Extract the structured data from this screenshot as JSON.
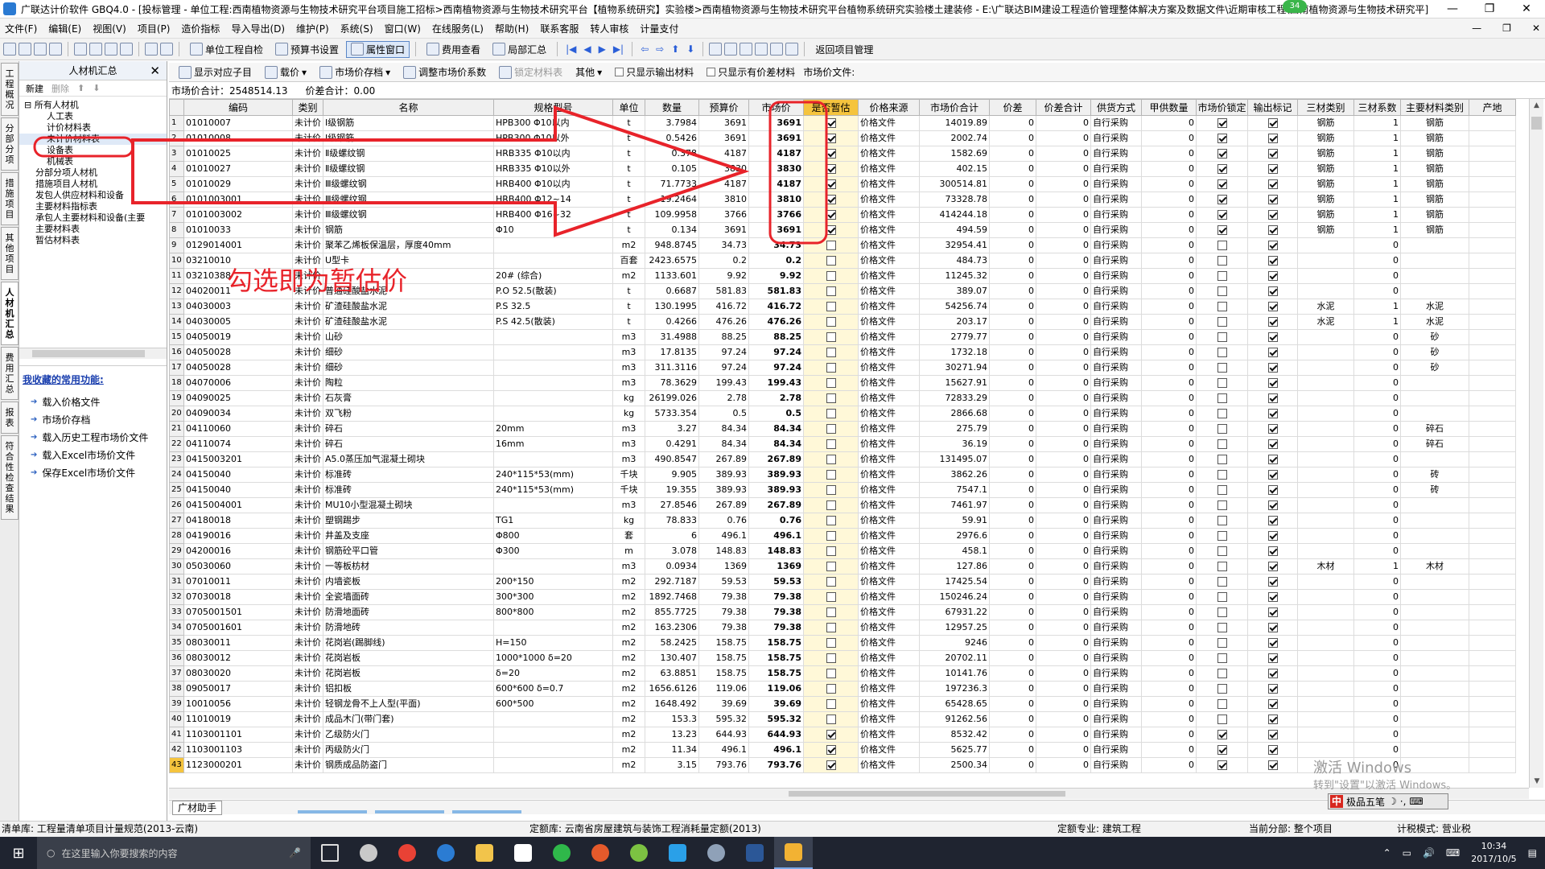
{
  "titlebar": {
    "title": "广联达计价软件 GBQ4.0 - [投标管理 - 单位工程:西南植物资源与生物技术研究平台项目施工招标>西南植物资源与生物技术研究平台【植物系统研究】实验楼>西南植物资源与生物技术研究平台植物系统研究实验楼土建装修 - E:\\广联达BIM建设工程造价管理整体解决方案及数据文件\\近期审核工程\\西南植物资源与生物技术研究平]",
    "badge": "34"
  },
  "menu": [
    "文件(F)",
    "编辑(E)",
    "视图(V)",
    "项目(P)",
    "造价指标",
    "导入导出(D)",
    "维护(P)",
    "系统(S)",
    "窗口(W)",
    "在线服务(L)",
    "帮助(H)",
    "联系客服",
    "转人审核",
    "计量支付"
  ],
  "toolbar": {
    "unit_check": "单位工程自检",
    "budget_setting": "预算书设置",
    "property_window": "属性窗口",
    "fee_view": "费用查看",
    "partial_summary": "局部汇总",
    "return_project": "返回项目管理"
  },
  "vtabs": [
    "工程概况",
    "分部分项",
    "措施项目",
    "其他项目",
    "人材机汇总",
    "费用汇总",
    "报表",
    "符合性检查结果"
  ],
  "left_panel": {
    "title": "人材机汇总",
    "new_label": "新建",
    "delete_label": "删除",
    "tree": [
      {
        "label": "所有人材机",
        "level": 0
      },
      {
        "label": "人工表",
        "level": 2
      },
      {
        "label": "计价材料表",
        "level": 2
      },
      {
        "label": "未计价材料表",
        "level": 2
      },
      {
        "label": "设备表",
        "level": 2
      },
      {
        "label": "机械表",
        "level": 2
      },
      {
        "label": "分部分项人材机",
        "level": 1
      },
      {
        "label": "措施项目人材机",
        "level": 1
      },
      {
        "label": "发包人供应材料和设备",
        "level": 1
      },
      {
        "label": "主要材料指标表",
        "level": 1
      },
      {
        "label": "承包人主要材料和设备(主要",
        "level": 1
      },
      {
        "label": "主要材料表",
        "level": 1
      },
      {
        "label": "暂估材料表",
        "level": 1
      }
    ],
    "fav_title": "我收藏的常用功能:",
    "fav_items": [
      "载入价格文件",
      "市场价存档",
      "载入历史工程市场价文件",
      "载入Excel市场价文件",
      "保存Excel市场价文件"
    ]
  },
  "sub_toolbar": {
    "show_sub": "显示对应子目",
    "pricing": "载价",
    "market_archive": "市场价存档",
    "adjust_coef": "调整市场价系数",
    "lock_material": "锁定材料表",
    "other": "其他",
    "only_output": "只显示输出材料",
    "only_diff": "只显示有价差材料",
    "market_file": "市场价文件:"
  },
  "summary": {
    "market_total": "市场价合计：2548514.13",
    "diff_total": "价差合计：0.00"
  },
  "table": {
    "headers": [
      "",
      "编码",
      "类别",
      "名称",
      "规格型号",
      "单位",
      "数量",
      "预算价",
      "市场价",
      "是否暂估",
      "价格来源",
      "市场价合计",
      "价差",
      "价差合计",
      "供货方式",
      "甲供数量",
      "市场价锁定",
      "输出标记",
      "三材类别",
      "三材系数",
      "主要材料类别",
      "产地"
    ],
    "rows": [
      [
        "1",
        "01010007",
        "未计价",
        "Ⅰ级钢筋",
        "HPB300 Φ10以内",
        "t",
        "3.7984",
        "3691",
        "3691",
        true,
        "价格文件",
        "14019.89",
        "0",
        "0",
        "自行采购",
        "0",
        true,
        true,
        "钢筋",
        "1",
        "钢筋",
        ""
      ],
      [
        "2",
        "01010008",
        "未计价",
        "Ⅰ级钢筋",
        "HPB300 Φ10以外",
        "t",
        "0.5426",
        "3691",
        "3691",
        true,
        "价格文件",
        "2002.74",
        "0",
        "0",
        "自行采购",
        "0",
        true,
        true,
        "钢筋",
        "1",
        "钢筋",
        ""
      ],
      [
        "3",
        "01010025",
        "未计价",
        "Ⅱ级螺纹钢",
        "HRB335 Φ10以内",
        "t",
        "0.378",
        "4187",
        "4187",
        true,
        "价格文件",
        "1582.69",
        "0",
        "0",
        "自行采购",
        "0",
        true,
        true,
        "钢筋",
        "1",
        "钢筋",
        ""
      ],
      [
        "4",
        "01010027",
        "未计价",
        "Ⅱ级螺纹钢",
        "HRB335 Φ10以外",
        "t",
        "0.105",
        "3830",
        "3830",
        true,
        "价格文件",
        "402.15",
        "0",
        "0",
        "自行采购",
        "0",
        true,
        true,
        "钢筋",
        "1",
        "钢筋",
        ""
      ],
      [
        "5",
        "01010029",
        "未计价",
        "Ⅲ级螺纹钢",
        "HRB400 Φ10以内",
        "t",
        "71.7733",
        "4187",
        "4187",
        true,
        "价格文件",
        "300514.81",
        "0",
        "0",
        "自行采购",
        "0",
        true,
        true,
        "钢筋",
        "1",
        "钢筋",
        ""
      ],
      [
        "6",
        "0101003001",
        "未计价",
        "Ⅲ级螺纹钢",
        "HRB400 Φ12~14",
        "t",
        "19.2464",
        "3810",
        "3810",
        true,
        "价格文件",
        "73328.78",
        "0",
        "0",
        "自行采购",
        "0",
        true,
        true,
        "钢筋",
        "1",
        "钢筋",
        ""
      ],
      [
        "7",
        "0101003002",
        "未计价",
        "Ⅲ级螺纹钢",
        "HRB400 Φ16~32",
        "t",
        "109.9958",
        "3766",
        "3766",
        true,
        "价格文件",
        "414244.18",
        "0",
        "0",
        "自行采购",
        "0",
        true,
        true,
        "钢筋",
        "1",
        "钢筋",
        ""
      ],
      [
        "8",
        "01010033",
        "未计价",
        "钢筋",
        "Φ10",
        "t",
        "0.134",
        "3691",
        "3691",
        true,
        "价格文件",
        "494.59",
        "0",
        "0",
        "自行采购",
        "0",
        true,
        true,
        "钢筋",
        "1",
        "钢筋",
        ""
      ],
      [
        "9",
        "0129014001",
        "未计价",
        "聚苯乙烯板保温层，厚度40mm",
        "",
        "m2",
        "948.8745",
        "34.73",
        "34.73",
        false,
        "价格文件",
        "32954.41",
        "0",
        "0",
        "自行采购",
        "0",
        false,
        true,
        "",
        "0",
        "",
        ""
      ],
      [
        "10",
        "03210010",
        "未计价",
        "U型卡",
        "",
        "百套",
        "2423.6575",
        "0.2",
        "0.2",
        false,
        "价格文件",
        "484.73",
        "0",
        "0",
        "自行采购",
        "0",
        false,
        true,
        "",
        "0",
        "",
        ""
      ],
      [
        "11",
        "03210388",
        "未计价",
        "",
        "20# (综合)",
        "m2",
        "1133.601",
        "9.92",
        "9.92",
        false,
        "价格文件",
        "11245.32",
        "0",
        "0",
        "自行采购",
        "0",
        false,
        true,
        "",
        "0",
        "",
        ""
      ],
      [
        "12",
        "04020011",
        "未计价",
        "普通硅酸盐水泥",
        "P.O 52.5(散装)",
        "t",
        "0.6687",
        "581.83",
        "581.83",
        false,
        "价格文件",
        "389.07",
        "0",
        "0",
        "自行采购",
        "0",
        false,
        true,
        "",
        "0",
        "",
        ""
      ],
      [
        "13",
        "04030003",
        "未计价",
        "矿渣硅酸盐水泥",
        "P.S 32.5",
        "t",
        "130.1995",
        "416.72",
        "416.72",
        false,
        "价格文件",
        "54256.74",
        "0",
        "0",
        "自行采购",
        "0",
        false,
        true,
        "水泥",
        "1",
        "水泥",
        ""
      ],
      [
        "14",
        "04030005",
        "未计价",
        "矿渣硅酸盐水泥",
        "P.S 42.5(散装)",
        "t",
        "0.4266",
        "476.26",
        "476.26",
        false,
        "价格文件",
        "203.17",
        "0",
        "0",
        "自行采购",
        "0",
        false,
        true,
        "水泥",
        "1",
        "水泥",
        ""
      ],
      [
        "15",
        "04050019",
        "未计价",
        "山砂",
        "",
        "m3",
        "31.4988",
        "88.25",
        "88.25",
        false,
        "价格文件",
        "2779.77",
        "0",
        "0",
        "自行采购",
        "0",
        false,
        true,
        "",
        "0",
        "砂",
        ""
      ],
      [
        "16",
        "04050028",
        "未计价",
        "细砂",
        "",
        "m3",
        "17.8135",
        "97.24",
        "97.24",
        false,
        "价格文件",
        "1732.18",
        "0",
        "0",
        "自行采购",
        "0",
        false,
        true,
        "",
        "0",
        "砂",
        ""
      ],
      [
        "17",
        "04050028",
        "未计价",
        "细砂",
        "",
        "m3",
        "311.3116",
        "97.24",
        "97.24",
        false,
        "价格文件",
        "30271.94",
        "0",
        "0",
        "自行采购",
        "0",
        false,
        true,
        "",
        "0",
        "砂",
        ""
      ],
      [
        "18",
        "04070006",
        "未计价",
        "陶粒",
        "",
        "m3",
        "78.3629",
        "199.43",
        "199.43",
        false,
        "价格文件",
        "15627.91",
        "0",
        "0",
        "自行采购",
        "0",
        false,
        true,
        "",
        "0",
        "",
        ""
      ],
      [
        "19",
        "04090025",
        "未计价",
        "石灰膏",
        "",
        "kg",
        "26199.026",
        "2.78",
        "2.78",
        false,
        "价格文件",
        "72833.29",
        "0",
        "0",
        "自行采购",
        "0",
        false,
        true,
        "",
        "0",
        "",
        ""
      ],
      [
        "20",
        "04090034",
        "未计价",
        "双飞粉",
        "",
        "kg",
        "5733.354",
        "0.5",
        "0.5",
        false,
        "价格文件",
        "2866.68",
        "0",
        "0",
        "自行采购",
        "0",
        false,
        true,
        "",
        "0",
        "",
        ""
      ],
      [
        "21",
        "04110060",
        "未计价",
        "碎石",
        "20mm",
        "m3",
        "3.27",
        "84.34",
        "84.34",
        false,
        "价格文件",
        "275.79",
        "0",
        "0",
        "自行采购",
        "0",
        false,
        true,
        "",
        "0",
        "碎石",
        ""
      ],
      [
        "22",
        "04110074",
        "未计价",
        "碎石",
        "16mm",
        "m3",
        "0.4291",
        "84.34",
        "84.34",
        false,
        "价格文件",
        "36.19",
        "0",
        "0",
        "自行采购",
        "0",
        false,
        true,
        "",
        "0",
        "碎石",
        ""
      ],
      [
        "23",
        "0415003201",
        "未计价",
        "A5.0蒸压加气混凝土砌块",
        "",
        "m3",
        "490.8547",
        "267.89",
        "267.89",
        false,
        "价格文件",
        "131495.07",
        "0",
        "0",
        "自行采购",
        "0",
        false,
        true,
        "",
        "0",
        "",
        ""
      ],
      [
        "24",
        "04150040",
        "未计价",
        "标准砖",
        "240*115*53(mm)",
        "千块",
        "9.905",
        "389.93",
        "389.93",
        false,
        "价格文件",
        "3862.26",
        "0",
        "0",
        "自行采购",
        "0",
        false,
        true,
        "",
        "0",
        "砖",
        ""
      ],
      [
        "25",
        "04150040",
        "未计价",
        "标准砖",
        "240*115*53(mm)",
        "千块",
        "19.355",
        "389.93",
        "389.93",
        false,
        "价格文件",
        "7547.1",
        "0",
        "0",
        "自行采购",
        "0",
        false,
        true,
        "",
        "0",
        "砖",
        ""
      ],
      [
        "26",
        "0415004001",
        "未计价",
        "MU10小型混凝土砌块",
        "",
        "m3",
        "27.8546",
        "267.89",
        "267.89",
        false,
        "价格文件",
        "7461.97",
        "0",
        "0",
        "自行采购",
        "0",
        false,
        true,
        "",
        "0",
        "",
        ""
      ],
      [
        "27",
        "04180018",
        "未计价",
        "塑钢踢步",
        "TG1",
        "kg",
        "78.833",
        "0.76",
        "0.76",
        false,
        "价格文件",
        "59.91",
        "0",
        "0",
        "自行采购",
        "0",
        false,
        true,
        "",
        "0",
        "",
        ""
      ],
      [
        "28",
        "04190016",
        "未计价",
        "井盖及支座",
        "Φ800",
        "套",
        "6",
        "496.1",
        "496.1",
        false,
        "价格文件",
        "2976.6",
        "0",
        "0",
        "自行采购",
        "0",
        false,
        true,
        "",
        "0",
        "",
        ""
      ],
      [
        "29",
        "04200016",
        "未计价",
        "钢筋砼平口管",
        "Φ300",
        "m",
        "3.078",
        "148.83",
        "148.83",
        false,
        "价格文件",
        "458.1",
        "0",
        "0",
        "自行采购",
        "0",
        false,
        true,
        "",
        "0",
        "",
        ""
      ],
      [
        "30",
        "05030060",
        "未计价",
        "一等板枋材",
        "",
        "m3",
        "0.0934",
        "1369",
        "1369",
        false,
        "价格文件",
        "127.86",
        "0",
        "0",
        "自行采购",
        "0",
        false,
        true,
        "木材",
        "1",
        "木材",
        ""
      ],
      [
        "31",
        "07010011",
        "未计价",
        "内墙瓷板",
        "200*150",
        "m2",
        "292.7187",
        "59.53",
        "59.53",
        false,
        "价格文件",
        "17425.54",
        "0",
        "0",
        "自行采购",
        "0",
        false,
        true,
        "",
        "0",
        "",
        ""
      ],
      [
        "32",
        "07030018",
        "未计价",
        "全瓷墙面砖",
        "300*300",
        "m2",
        "1892.7468",
        "79.38",
        "79.38",
        false,
        "价格文件",
        "150246.24",
        "0",
        "0",
        "自行采购",
        "0",
        false,
        true,
        "",
        "0",
        "",
        ""
      ],
      [
        "33",
        "0705001501",
        "未计价",
        "防滑地面砖",
        "800*800",
        "m2",
        "855.7725",
        "79.38",
        "79.38",
        false,
        "价格文件",
        "67931.22",
        "0",
        "0",
        "自行采购",
        "0",
        false,
        true,
        "",
        "0",
        "",
        ""
      ],
      [
        "34",
        "0705001601",
        "未计价",
        "防滑地砖",
        "",
        "m2",
        "163.2306",
        "79.38",
        "79.38",
        false,
        "价格文件",
        "12957.25",
        "0",
        "0",
        "自行采购",
        "0",
        false,
        true,
        "",
        "0",
        "",
        ""
      ],
      [
        "35",
        "08030011",
        "未计价",
        "花岗岩(踢脚线)",
        "H=150",
        "m2",
        "58.2425",
        "158.75",
        "158.75",
        false,
        "价格文件",
        "9246",
        "0",
        "0",
        "自行采购",
        "0",
        false,
        true,
        "",
        "0",
        "",
        ""
      ],
      [
        "36",
        "08030012",
        "未计价",
        "花岗岩板",
        "1000*1000 δ=20",
        "m2",
        "130.407",
        "158.75",
        "158.75",
        false,
        "价格文件",
        "20702.11",
        "0",
        "0",
        "自行采购",
        "0",
        false,
        true,
        "",
        "0",
        "",
        ""
      ],
      [
        "37",
        "08030020",
        "未计价",
        "花岗岩板",
        "δ=20",
        "m2",
        "63.8851",
        "158.75",
        "158.75",
        false,
        "价格文件",
        "10141.76",
        "0",
        "0",
        "自行采购",
        "0",
        false,
        true,
        "",
        "0",
        "",
        ""
      ],
      [
        "38",
        "09050017",
        "未计价",
        "铝扣板",
        "600*600 δ=0.7",
        "m2",
        "1656.6126",
        "119.06",
        "119.06",
        false,
        "价格文件",
        "197236.3",
        "0",
        "0",
        "自行采购",
        "0",
        false,
        true,
        "",
        "0",
        "",
        ""
      ],
      [
        "39",
        "10010056",
        "未计价",
        "轻钢龙骨不上人型(平面)",
        "600*500",
        "m2",
        "1648.492",
        "39.69",
        "39.69",
        false,
        "价格文件",
        "65428.65",
        "0",
        "0",
        "自行采购",
        "0",
        false,
        true,
        "",
        "0",
        "",
        ""
      ],
      [
        "40",
        "11010019",
        "未计价",
        "成品木门(带门套)",
        "",
        "m2",
        "153.3",
        "595.32",
        "595.32",
        false,
        "价格文件",
        "91262.56",
        "0",
        "0",
        "自行采购",
        "0",
        false,
        true,
        "",
        "0",
        "",
        ""
      ],
      [
        "41",
        "1103001101",
        "未计价",
        "乙级防火门",
        "",
        "m2",
        "13.23",
        "644.93",
        "644.93",
        true,
        "价格文件",
        "8532.42",
        "0",
        "0",
        "自行采购",
        "0",
        true,
        true,
        "",
        "0",
        "",
        ""
      ],
      [
        "42",
        "1103001103",
        "未计价",
        "丙级防火门",
        "",
        "m2",
        "11.34",
        "496.1",
        "496.1",
        true,
        "价格文件",
        "5625.77",
        "0",
        "0",
        "自行采购",
        "0",
        true,
        true,
        "",
        "0",
        "",
        ""
      ],
      [
        "43",
        "1123000201",
        "未计价",
        "钢质成品防盗门",
        "",
        "m2",
        "3.15",
        "793.76",
        "793.76",
        true,
        "价格文件",
        "2500.34",
        "0",
        "0",
        "自行采购",
        "0",
        true,
        true,
        "",
        "0",
        "",
        ""
      ]
    ]
  },
  "annotation": {
    "text": "勾选即为暂估价",
    "color": "#e8232a"
  },
  "helper_tab": "广材助手",
  "status": {
    "list_lib": "清单库:  工程量清单项目计量规范(2013-云南)",
    "quota_lib": "定额库:  云南省房屋建筑与装饰工程消耗量定额(2013)",
    "quota_major": "定额专业:  建筑工程",
    "current_part": "当前分部:  整个项目",
    "tax_mode": "计税模式:  营业税"
  },
  "watermark": {
    "line1": "激活 Windows",
    "line2": "转到\"设置\"以激活 Windows。"
  },
  "ime": {
    "name": "极品五笔"
  },
  "taskbar": {
    "search_placeholder": "在这里输入你要搜索的内容",
    "time": "10:34",
    "date": "2017/10/5"
  },
  "colors": {
    "highlight_red": "#e8232a",
    "selected_row": "#f5c43e",
    "link_blue": "#1a3fae"
  }
}
